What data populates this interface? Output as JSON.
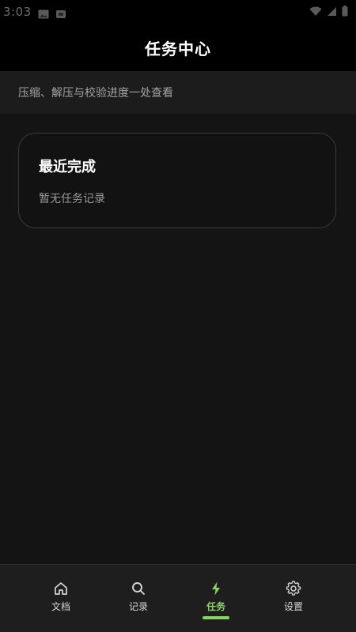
{
  "status_bar": {
    "time": "3:03",
    "left_icons": [
      "image-icon",
      "android-debug-icon"
    ],
    "right_icons": [
      "wifi-icon",
      "signal-icon",
      "battery-icon"
    ]
  },
  "app_bar": {
    "title": "任务中心"
  },
  "subtitle": "压缩、解压与校验进度一处查看",
  "recent_card": {
    "title": "最近完成",
    "empty_text": "暂无任务记录"
  },
  "bottom_nav": {
    "active_index": 2,
    "accent_color": "#8fd06a",
    "items": [
      {
        "label": "文档",
        "icon": "home-icon"
      },
      {
        "label": "记录",
        "icon": "search-icon"
      },
      {
        "label": "任务",
        "icon": "bolt-icon"
      },
      {
        "label": "设置",
        "icon": "gear-icon"
      }
    ]
  }
}
